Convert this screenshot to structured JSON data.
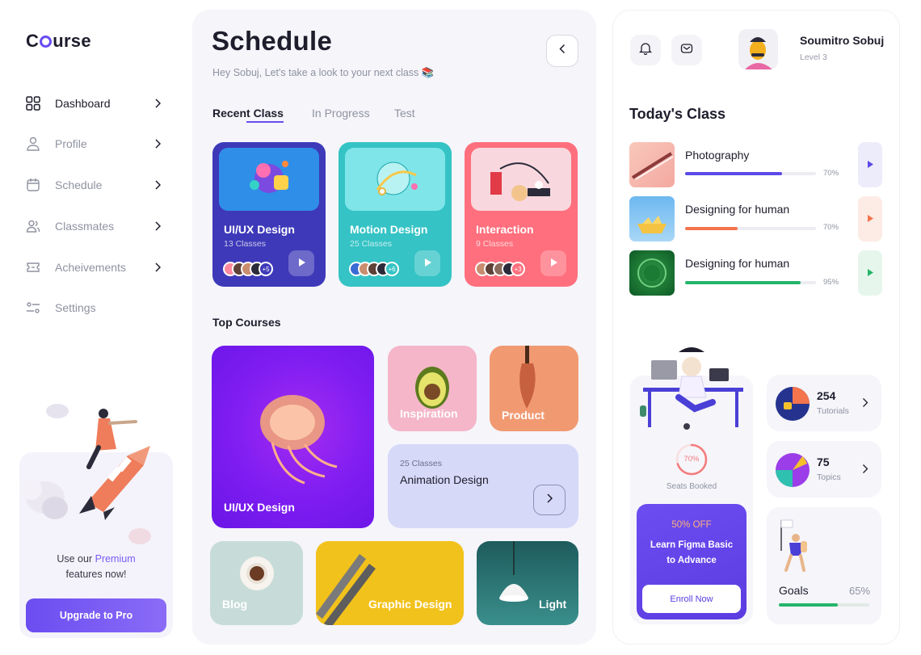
{
  "brand": {
    "prefix": "C",
    "suffix": "urse"
  },
  "colors": {
    "accent": "#6a4cf2",
    "orange": "#f3744d",
    "green": "#26b56a"
  },
  "sidebar": {
    "items": [
      {
        "label": "Dashboard",
        "icon": "grid-icon"
      },
      {
        "label": "Profile",
        "icon": "user-icon"
      },
      {
        "label": "Schedule",
        "icon": "calendar-icon"
      },
      {
        "label": "Classmates",
        "icon": "users-icon"
      },
      {
        "label": "Acheivements",
        "icon": "ticket-icon"
      },
      {
        "label": "Settings",
        "icon": "sliders-icon"
      }
    ],
    "promo": {
      "line1_pre": "Use our ",
      "line1_highlight": "Premium",
      "line2": "features now!",
      "button": "Upgrade to Pro"
    }
  },
  "header": {
    "title": "Schedule",
    "subtitle": "Hey Sobuj, Let's take a look to your next class 📚"
  },
  "tabs": [
    {
      "label": "Recent Class"
    },
    {
      "label": "In Progress"
    },
    {
      "label": "Test"
    }
  ],
  "recent_classes": [
    {
      "title": "UI/UX Design",
      "count": "13 Classes",
      "extra": "+5",
      "color": "#3d39b9"
    },
    {
      "title": "Motion Design",
      "count": "25 Classes",
      "extra": "+6",
      "color": "#35c3c5"
    },
    {
      "title": "Interaction",
      "count": "9 Classes",
      "extra": "+3",
      "color": "#ff6f7d"
    }
  ],
  "top_courses": {
    "title": "Top Courses",
    "items": [
      {
        "label": "UI/UX Design"
      },
      {
        "label": "Inspiration"
      },
      {
        "label": "Product"
      },
      {
        "label": "Animation Design",
        "count": "25 Classes"
      },
      {
        "label": "Blog"
      },
      {
        "label": "Graphic Design"
      },
      {
        "label": "Light"
      }
    ]
  },
  "user": {
    "name": "Soumitro Sobuj",
    "level": "Level 3"
  },
  "today": {
    "title": "Today's Class",
    "items": [
      {
        "title": "Photography",
        "pct_label": "70%",
        "progress": 0.74,
        "color": "#5b4ae6"
      },
      {
        "title": "Designing for human",
        "pct_label": "70%",
        "progress": 0.4,
        "color": "#f3744d"
      },
      {
        "title": "Designing for human",
        "pct_label": "95%",
        "progress": 0.88,
        "color": "#26b56a"
      }
    ]
  },
  "seats": {
    "pct": "70%",
    "value": 0.7,
    "label": "Seats Booked"
  },
  "offer": {
    "discount": "50% OFF",
    "line1": "Learn Figma Basic",
    "line2": "to Advance",
    "button": "Enroll Now"
  },
  "stats": [
    {
      "num": "254",
      "label": "Tutorials"
    },
    {
      "num": "75",
      "label": "Topics"
    }
  ],
  "goals": {
    "label": "Goals",
    "pct": "65%",
    "value": 0.65
  }
}
